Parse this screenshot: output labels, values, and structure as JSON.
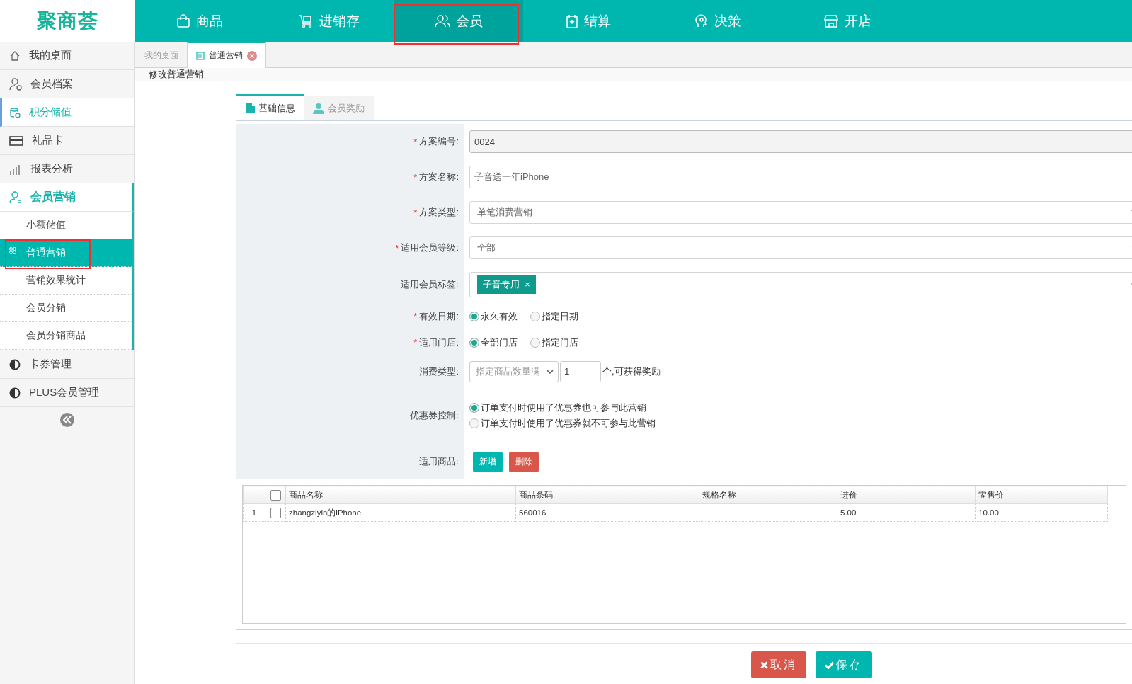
{
  "logo": {
    "text": "聚商荟"
  },
  "top_nav": [
    {
      "label": "商品",
      "selected": false,
      "highlighted": false
    },
    {
      "label": "进销存",
      "selected": false,
      "highlighted": false
    },
    {
      "label": "会员",
      "selected": true,
      "highlighted": true
    },
    {
      "label": "结算",
      "selected": false,
      "highlighted": false
    },
    {
      "label": "决策",
      "selected": false,
      "highlighted": false
    },
    {
      "label": "开店",
      "selected": false,
      "highlighted": false
    }
  ],
  "sidebar": {
    "items": [
      {
        "label": "我的桌面",
        "active": false,
        "expanded": false
      },
      {
        "label": "会员档案",
        "active": false,
        "expanded": false
      },
      {
        "label": "积分储值",
        "active": true,
        "expanded": false
      },
      {
        "label": "礼品卡",
        "active": false,
        "expanded": false
      },
      {
        "label": "报表分析",
        "active": false,
        "expanded": false
      },
      {
        "label": "会员营销",
        "active": false,
        "expanded": true,
        "children": [
          {
            "label": "小额储值",
            "selected": false,
            "highlighted": false
          },
          {
            "label": "普通营销",
            "selected": true,
            "highlighted": true
          },
          {
            "label": "营销效果统计",
            "selected": false,
            "highlighted": false
          },
          {
            "label": "会员分销",
            "selected": false,
            "highlighted": false
          },
          {
            "label": "会员分销商品",
            "selected": false,
            "highlighted": false
          }
        ]
      },
      {
        "label": "卡券管理",
        "active": false,
        "expanded": false
      },
      {
        "label": "PLUS会员管理",
        "active": false,
        "expanded": false
      }
    ]
  },
  "page_tabs": [
    {
      "label": "我的桌面",
      "selected": false,
      "closable": false
    },
    {
      "label": "普通营销",
      "selected": true,
      "closable": true
    }
  ],
  "page_title": "修改普通营销",
  "form_tabs": [
    {
      "label": "基础信息",
      "selected": true
    },
    {
      "label": "会员奖励",
      "selected": false
    }
  ],
  "fields": [
    {
      "kind": "input",
      "required_mark": "*",
      "label": "方案编号:",
      "value": "0024",
      "disabled": true
    },
    {
      "kind": "input",
      "required_mark": "*",
      "label": "方案名称:",
      "value": "子音送一年iPhone",
      "disabled": false
    },
    {
      "kind": "select",
      "required_mark": "*",
      "label": "方案类型:",
      "value": "单笔消费营销"
    },
    {
      "kind": "select",
      "required_mark": "*",
      "label": "适用会员等级:",
      "value": "全部"
    },
    {
      "kind": "tags",
      "label": "适用会员标签:",
      "tags": [
        {
          "label": "子音专用",
          "remove": "×"
        }
      ]
    },
    {
      "kind": "radio",
      "required_mark": "*",
      "label": "有效日期:",
      "options": [
        {
          "label": "永久有效",
          "selected": true
        },
        {
          "label": "指定日期",
          "selected": false
        }
      ]
    },
    {
      "kind": "radio",
      "required_mark": "*",
      "label": "适用门店:",
      "options": [
        {
          "label": "全部门店",
          "selected": true
        },
        {
          "label": "指定门店",
          "selected": false
        }
      ]
    },
    {
      "kind": "consume",
      "label": "消费类型:",
      "select": "指定商品数量满",
      "value": "1",
      "suffix": "个,可获得奖励"
    },
    {
      "kind": "radio-stack",
      "label": "优惠券控制:",
      "options": [
        {
          "label": "订单支付时使用了优惠券也可参与此营销",
          "selected": true
        },
        {
          "label": "订单支付时使用了优惠券就不可参与此营销",
          "selected": false
        }
      ]
    },
    {
      "kind": "buttons",
      "label": "适用商品:",
      "buttons": [
        {
          "label": "新增",
          "kind": "primary"
        },
        {
          "label": "删除",
          "kind": "danger"
        }
      ]
    }
  ],
  "table": {
    "all_checked": false,
    "columns": [
      "商品名称",
      "商品条码",
      "规格名称",
      "进价",
      "零售价"
    ],
    "rows": [
      {
        "index": "1",
        "checked": false,
        "cells": [
          "zhangziyin的iPhone",
          "560016",
          "",
          "5.00",
          "10.00"
        ]
      }
    ]
  },
  "footer_buttons": [
    {
      "label": "取消",
      "kind": "cancel"
    },
    {
      "label": "保存",
      "kind": "save"
    }
  ]
}
